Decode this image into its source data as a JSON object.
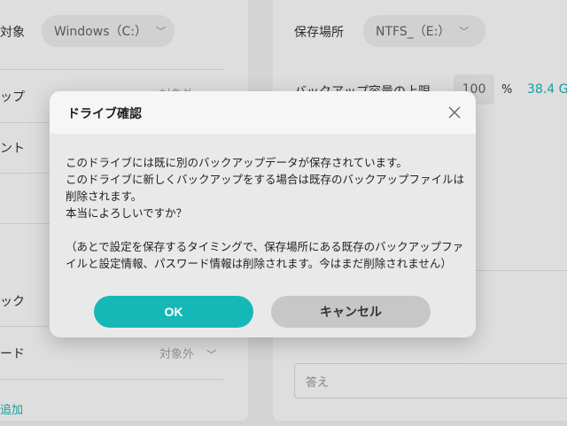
{
  "left": {
    "target_label": "対象",
    "drive_select": "Windows（C:）",
    "row2_label": "ップ",
    "row2_value": "対象外",
    "row3_label": "ント",
    "row4_label": "ック",
    "row5_label": "ード",
    "row5_value": "対象外",
    "add_link": "追加"
  },
  "right": {
    "save_location_label": "保存場所",
    "save_drive_select": "NTFS_（E:）",
    "capacity_label": "バックアップ容量の上限",
    "capacity_value": "100",
    "capacity_unit": "%",
    "capacity_size": "38.4 G",
    "answer_placeholder": "答え"
  },
  "dialog": {
    "title": "ドライブ確認",
    "line1": "このドライブには既に別のバックアップデータが保存されています。",
    "line2": "このドライブに新しくバックアップをする場合は既存のバックアップファイルは削除されます。",
    "line3": "本当によろしいですか？",
    "line4": "（あとで設定を保存するタイミングで、保存場所にある既存のバックアップファイルと設定情報、パスワード情報は削除されます。今はまだ削除されません）",
    "ok_label": "OK",
    "cancel_label": "キャンセル"
  },
  "colors": {
    "accent": "#16b8b7",
    "cancel": "#c7c7c7"
  }
}
